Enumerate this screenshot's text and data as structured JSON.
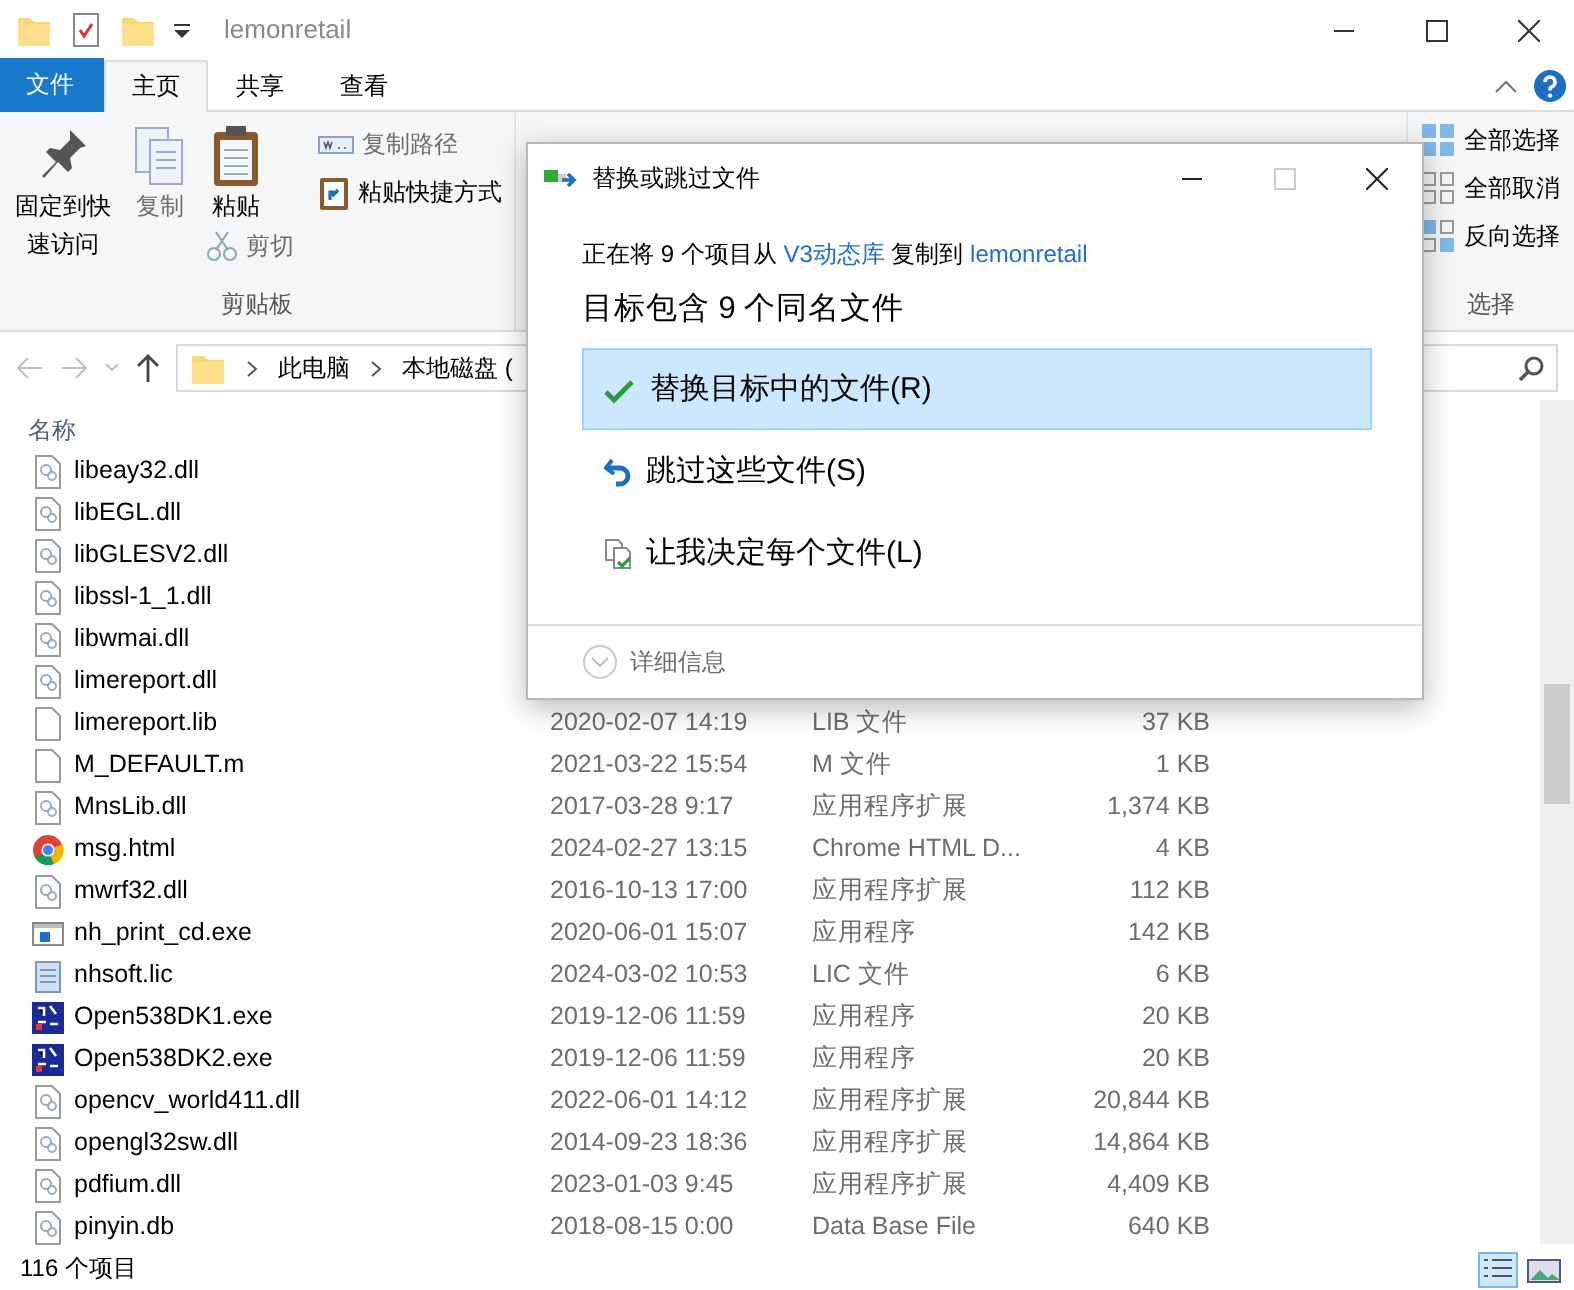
{
  "window": {
    "title": "lemonretail"
  },
  "ribbon_tabs": [
    {
      "label": "文件",
      "kind": "file",
      "selected": false
    },
    {
      "label": "主页",
      "kind": "tab",
      "selected": true
    },
    {
      "label": "共享",
      "kind": "tab",
      "selected": false
    },
    {
      "label": "查看",
      "kind": "tab",
      "selected": false
    }
  ],
  "clipboard_group": {
    "label": "剪贴板",
    "pin": "固定到快速访问",
    "copy": "复制",
    "paste": "粘贴",
    "cut": "剪切",
    "copy_path": "复制路径",
    "paste_shortcut": "粘贴快捷方式"
  },
  "select_group": {
    "label": "选择",
    "commands": [
      {
        "label": "全部选择",
        "kind": "all"
      },
      {
        "label": "全部取消",
        "kind": "none"
      },
      {
        "label": "反向选择",
        "kind": "invert"
      }
    ]
  },
  "address": {
    "crumbs": [
      "此电脑",
      "本地磁盘 ("
    ]
  },
  "file_list": {
    "columns": [
      "名称"
    ],
    "rows": [
      {
        "name": "libeay32.dll",
        "kind": "dll"
      },
      {
        "name": "libEGL.dll",
        "kind": "dll"
      },
      {
        "name": "libGLESV2.dll",
        "kind": "dll"
      },
      {
        "name": "libssl-1_1.dll",
        "kind": "dll"
      },
      {
        "name": "libwmai.dll",
        "kind": "dll"
      },
      {
        "name": "limereport.dll",
        "kind": "dll"
      },
      {
        "name": "limereport.lib",
        "kind": "blank",
        "date": "2020-02-07 14:19",
        "type": "LIB 文件",
        "size": "37 KB"
      },
      {
        "name": "M_DEFAULT.m",
        "kind": "blank",
        "date": "2021-03-22 15:54",
        "type": "M 文件",
        "size": "1 KB"
      },
      {
        "name": "MnsLib.dll",
        "kind": "dll",
        "date": "2017-03-28 9:17",
        "type": "应用程序扩展",
        "size": "1,374 KB"
      },
      {
        "name": "msg.html",
        "kind": "chrome",
        "date": "2024-02-27 13:15",
        "type": "Chrome HTML D...",
        "size": "4 KB"
      },
      {
        "name": "mwrf32.dll",
        "kind": "dll",
        "date": "2016-10-13 17:00",
        "type": "应用程序扩展",
        "size": "112 KB"
      },
      {
        "name": "nh_print_cd.exe",
        "kind": "window",
        "date": "2020-06-01 15:07",
        "type": "应用程序",
        "size": "142 KB"
      },
      {
        "name": "nhsoft.lic",
        "kind": "text",
        "date": "2024-03-02 10:53",
        "type": "LIC 文件",
        "size": "6 KB"
      },
      {
        "name": "Open538DK1.exe",
        "kind": "app",
        "date": "2019-12-06 11:59",
        "type": "应用程序",
        "size": "20 KB"
      },
      {
        "name": "Open538DK2.exe",
        "kind": "app",
        "date": "2019-12-06 11:59",
        "type": "应用程序",
        "size": "20 KB"
      },
      {
        "name": "opencv_world411.dll",
        "kind": "dll",
        "date": "2022-06-01 14:12",
        "type": "应用程序扩展",
        "size": "20,844 KB"
      },
      {
        "name": "opengl32sw.dll",
        "kind": "dll",
        "date": "2014-09-23 18:36",
        "type": "应用程序扩展",
        "size": "14,864 KB"
      },
      {
        "name": "pdfium.dll",
        "kind": "dll",
        "date": "2023-01-03 9:45",
        "type": "应用程序扩展",
        "size": "4,409 KB"
      },
      {
        "name": "pinyin.db",
        "kind": "dll",
        "date": "2018-08-15 0:00",
        "type": "Data Base File",
        "size": "640 KB"
      }
    ]
  },
  "status_bar": {
    "count": "116 个项目"
  },
  "dialog": {
    "title": "替换或跳过文件",
    "message": {
      "prefix": "正在将 9 个项目从",
      "source": "V3动态库",
      "middle": "复制到",
      "target": "lemonretail"
    },
    "heading": "目标包含 9 个同名文件",
    "options": [
      {
        "label": "替换目标中的文件(R)",
        "kind": "replace",
        "selected": true
      },
      {
        "label": "跳过这些文件(S)",
        "kind": "skip",
        "selected": false
      },
      {
        "label": "让我决定每个文件(L)",
        "kind": "decide",
        "selected": false
      }
    ],
    "details": "详细信息"
  }
}
